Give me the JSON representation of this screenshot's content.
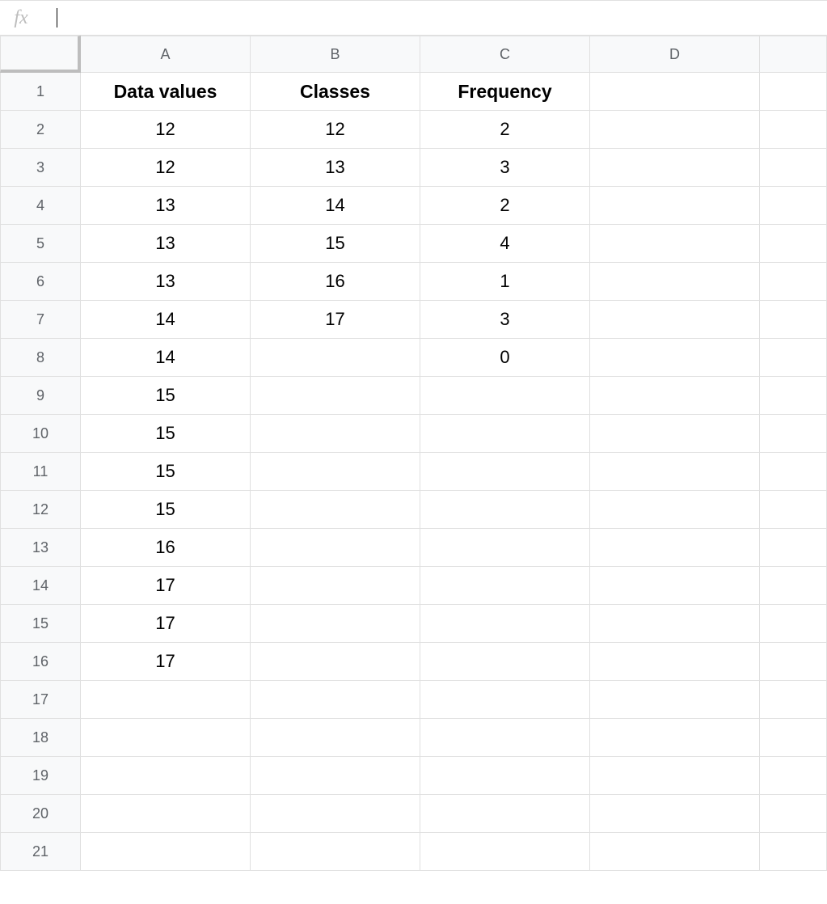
{
  "formula_bar": {
    "fx_label": "fx",
    "value": ""
  },
  "columns": [
    "A",
    "B",
    "C",
    "D",
    ""
  ],
  "rows": [
    "1",
    "2",
    "3",
    "4",
    "5",
    "6",
    "7",
    "8",
    "9",
    "10",
    "11",
    "12",
    "13",
    "14",
    "15",
    "16",
    "17",
    "18",
    "19",
    "20",
    "21"
  ],
  "cells": {
    "r1": {
      "A": "Data values",
      "B": "Classes",
      "C": "Frequency",
      "D": "",
      "E": ""
    },
    "r2": {
      "A": "12",
      "B": "12",
      "C": "2",
      "D": "",
      "E": ""
    },
    "r3": {
      "A": "12",
      "B": "13",
      "C": "3",
      "D": "",
      "E": ""
    },
    "r4": {
      "A": "13",
      "B": "14",
      "C": "2",
      "D": "",
      "E": ""
    },
    "r5": {
      "A": "13",
      "B": "15",
      "C": "4",
      "D": "",
      "E": ""
    },
    "r6": {
      "A": "13",
      "B": "16",
      "C": "1",
      "D": "",
      "E": ""
    },
    "r7": {
      "A": "14",
      "B": "17",
      "C": "3",
      "D": "",
      "E": ""
    },
    "r8": {
      "A": "14",
      "B": "",
      "C": "0",
      "D": "",
      "E": ""
    },
    "r9": {
      "A": "15",
      "B": "",
      "C": "",
      "D": "",
      "E": ""
    },
    "r10": {
      "A": "15",
      "B": "",
      "C": "",
      "D": "",
      "E": ""
    },
    "r11": {
      "A": "15",
      "B": "",
      "C": "",
      "D": "",
      "E": ""
    },
    "r12": {
      "A": "15",
      "B": "",
      "C": "",
      "D": "",
      "E": ""
    },
    "r13": {
      "A": "16",
      "B": "",
      "C": "",
      "D": "",
      "E": ""
    },
    "r14": {
      "A": "17",
      "B": "",
      "C": "",
      "D": "",
      "E": ""
    },
    "r15": {
      "A": "17",
      "B": "",
      "C": "",
      "D": "",
      "E": ""
    },
    "r16": {
      "A": "17",
      "B": "",
      "C": "",
      "D": "",
      "E": ""
    },
    "r17": {
      "A": "",
      "B": "",
      "C": "",
      "D": "",
      "E": ""
    },
    "r18": {
      "A": "",
      "B": "",
      "C": "",
      "D": "",
      "E": ""
    },
    "r19": {
      "A": "",
      "B": "",
      "C": "",
      "D": "",
      "E": ""
    },
    "r20": {
      "A": "",
      "B": "",
      "C": "",
      "D": "",
      "E": ""
    },
    "r21": {
      "A": "",
      "B": "",
      "C": "",
      "D": "",
      "E": ""
    }
  }
}
